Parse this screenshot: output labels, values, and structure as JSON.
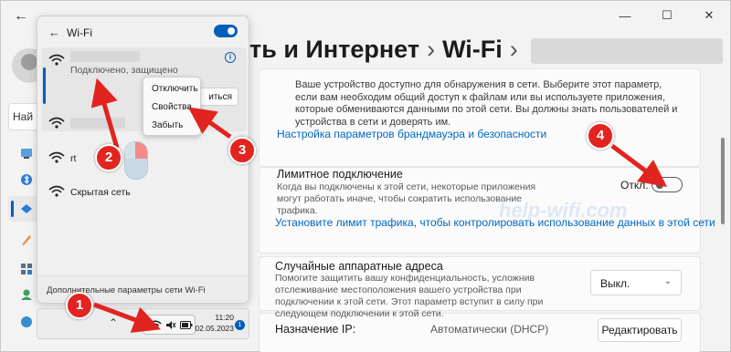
{
  "window": {
    "controls": {
      "minimize": "—",
      "maximize": "☐",
      "close": "✕"
    },
    "back": "←"
  },
  "sidebar": {
    "search_stub": "Най",
    "icons": [
      "home-icon",
      "bluetooth-icon",
      "network-icon",
      "personalization-icon",
      "apps-icon",
      "accounts-icon",
      "time-icon",
      "gaming-icon",
      "accessibility-icon"
    ]
  },
  "header": {
    "part1": "ть и Интернет",
    "separator": "›",
    "part2": "Wi-Fi",
    "separator2": "›"
  },
  "content": {
    "discover_text": "Ваше устройство доступно для обнаружения в сети. Выберите этот параметр, если вам необходим общий доступ к файлам или вы используете приложения, которые обмениваются данными по этой сети. Вы должны знать пользователей и устройства в сети и доверять им.",
    "firewall_link": "Настройка параметров брандмауэра и безопасности",
    "metered": {
      "title": "Лимитное подключение",
      "desc": "Когда вы подключены к этой сети, некоторые приложения могут работать иначе, чтобы сократить использование трафика.",
      "toggle_label": "Откл.",
      "toggle_on": false
    },
    "limit_link": "Установите лимит трафика, чтобы контролировать использование данных в этой сети",
    "random_mac": {
      "title": "Случайные аппаратные адреса",
      "desc": "Помогите защитить вашу конфиденциальность, усложнив отслеживание местоположения вашего устройства при подключении к этой сети. Этот параметр вступит в силу при следующем подключении к этой сети.",
      "value": "Выкл."
    },
    "ip": {
      "label": "Назначение IP:",
      "value": "Автоматически (DHCP)",
      "button": "Редактировать"
    },
    "watermark": "help-wifi.com"
  },
  "flyout": {
    "title": "Wi-Fi",
    "wifi_on": true,
    "connected": {
      "status": "Подключено, защищено",
      "disconnect_partial": "иться"
    },
    "networks": [
      {
        "name": "rt"
      },
      {
        "name": "Скрытая сеть"
      }
    ],
    "footer": "Дополнительные параметры сети Wi-Fi"
  },
  "context_menu": {
    "items": [
      "Отключить",
      "Свойства",
      "Забыть"
    ]
  },
  "taskbar": {
    "up_arrow": "⌃",
    "time": "11:20",
    "date": "02.05.2023",
    "badge": "1"
  },
  "annotations": [
    "1",
    "2",
    "3",
    "4"
  ],
  "colors": {
    "accent": "#005fb8",
    "link": "#0067c0",
    "annotation": "#e12420"
  }
}
